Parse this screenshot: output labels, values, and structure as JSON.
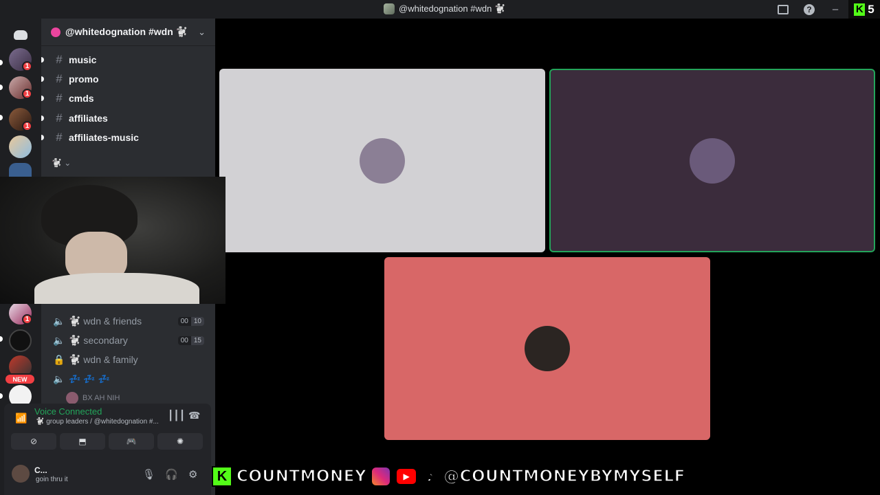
{
  "window": {
    "title": "@whitedognation #wdn 🐩",
    "kick_count": "5",
    "kick_logo": "K",
    "icons": [
      "inbox-icon",
      "help-icon",
      "minimize-icon",
      "maximize-icon"
    ]
  },
  "server_rail": {
    "new_badge": "NEW",
    "badges": [
      "1",
      "1",
      "1",
      "1"
    ]
  },
  "sidebar": {
    "server_name": "@whitedognation #wdn 🐩",
    "channels": [
      {
        "name": "music"
      },
      {
        "name": "promo"
      },
      {
        "name": "cmds"
      },
      {
        "name": "affiliates"
      },
      {
        "name": "affiliates-music"
      }
    ],
    "category_label": "🐩",
    "voice_channels": [
      {
        "name": "🐩 wdn & friends",
        "count": "00",
        "limit": "10"
      },
      {
        "name": "🐩 secondary",
        "count": "00",
        "limit": "15"
      },
      {
        "name": "🐩 wdn & family"
      },
      {
        "name": "💤 💤 💤"
      }
    ],
    "sub_member": "BX AH NIH"
  },
  "voice_panel": {
    "status": "Voice Connected",
    "location": "🐩 group leaders / @whitedognation #...",
    "buttons": [
      "video-off-icon",
      "screen-share-icon",
      "activity-icon",
      "soundboard-icon"
    ]
  },
  "user_panel": {
    "name": "C...",
    "status": "goin thru it"
  },
  "stage": {
    "tiles": [
      {
        "bg": "#d2d1d4",
        "avatar_color": "#8b7f95"
      },
      {
        "bg": "#3b2c3c",
        "avatar_color": "#6a5a7a",
        "speaking": true
      },
      {
        "bg": "#d86767",
        "avatar_color": "#2b2522"
      }
    ]
  },
  "banner": {
    "kick_letter": "K",
    "handle_1": "COUNTMONEY",
    "youtube_glyph": "▶",
    "tiktok_glyph": "♪",
    "handle_2": "@COUNTMONEYBYMYSELF"
  }
}
